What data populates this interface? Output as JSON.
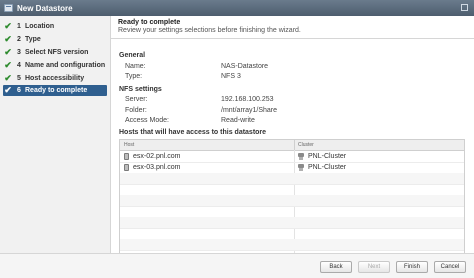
{
  "window": {
    "title": "New Datastore"
  },
  "steps": [
    {
      "num": "1",
      "label": "Location",
      "done": true,
      "active": false
    },
    {
      "num": "2",
      "label": "Type",
      "done": true,
      "active": false
    },
    {
      "num": "3",
      "label": "Select NFS version",
      "done": true,
      "active": false
    },
    {
      "num": "4",
      "label": "Name and configuration",
      "done": true,
      "active": false
    },
    {
      "num": "5",
      "label": "Host accessibility",
      "done": true,
      "active": false
    },
    {
      "num": "6",
      "label": "Ready to complete",
      "done": true,
      "active": true
    }
  ],
  "header": {
    "title": "Ready to complete",
    "subtitle": "Review your settings selections before finishing the wizard."
  },
  "general": {
    "heading": "General",
    "name_label": "Name:",
    "name_value": "NAS-Datastore",
    "type_label": "Type:",
    "type_value": "NFS 3"
  },
  "nfs": {
    "heading": "NFS settings",
    "server_label": "Server:",
    "server_value": "192.168.100.253",
    "folder_label": "Folder:",
    "folder_value": "/mnt/array1/Share",
    "access_label": "Access Mode:",
    "access_value": "Read-write"
  },
  "hosts": {
    "heading": "Hosts that will have access to this datastore",
    "col_host": "Host",
    "col_cluster": "Cluster",
    "rows": [
      {
        "host": "esx-02.pnl.com",
        "cluster": "PNL-Cluster"
      },
      {
        "host": "esx-03.pnl.com",
        "cluster": "PNL-Cluster"
      }
    ]
  },
  "buttons": {
    "back": "Back",
    "next": "Next",
    "finish": "Finish",
    "cancel": "Cancel"
  },
  "icons": {
    "check": "check-icon",
    "host": "host-icon",
    "cluster": "cluster-icon"
  }
}
